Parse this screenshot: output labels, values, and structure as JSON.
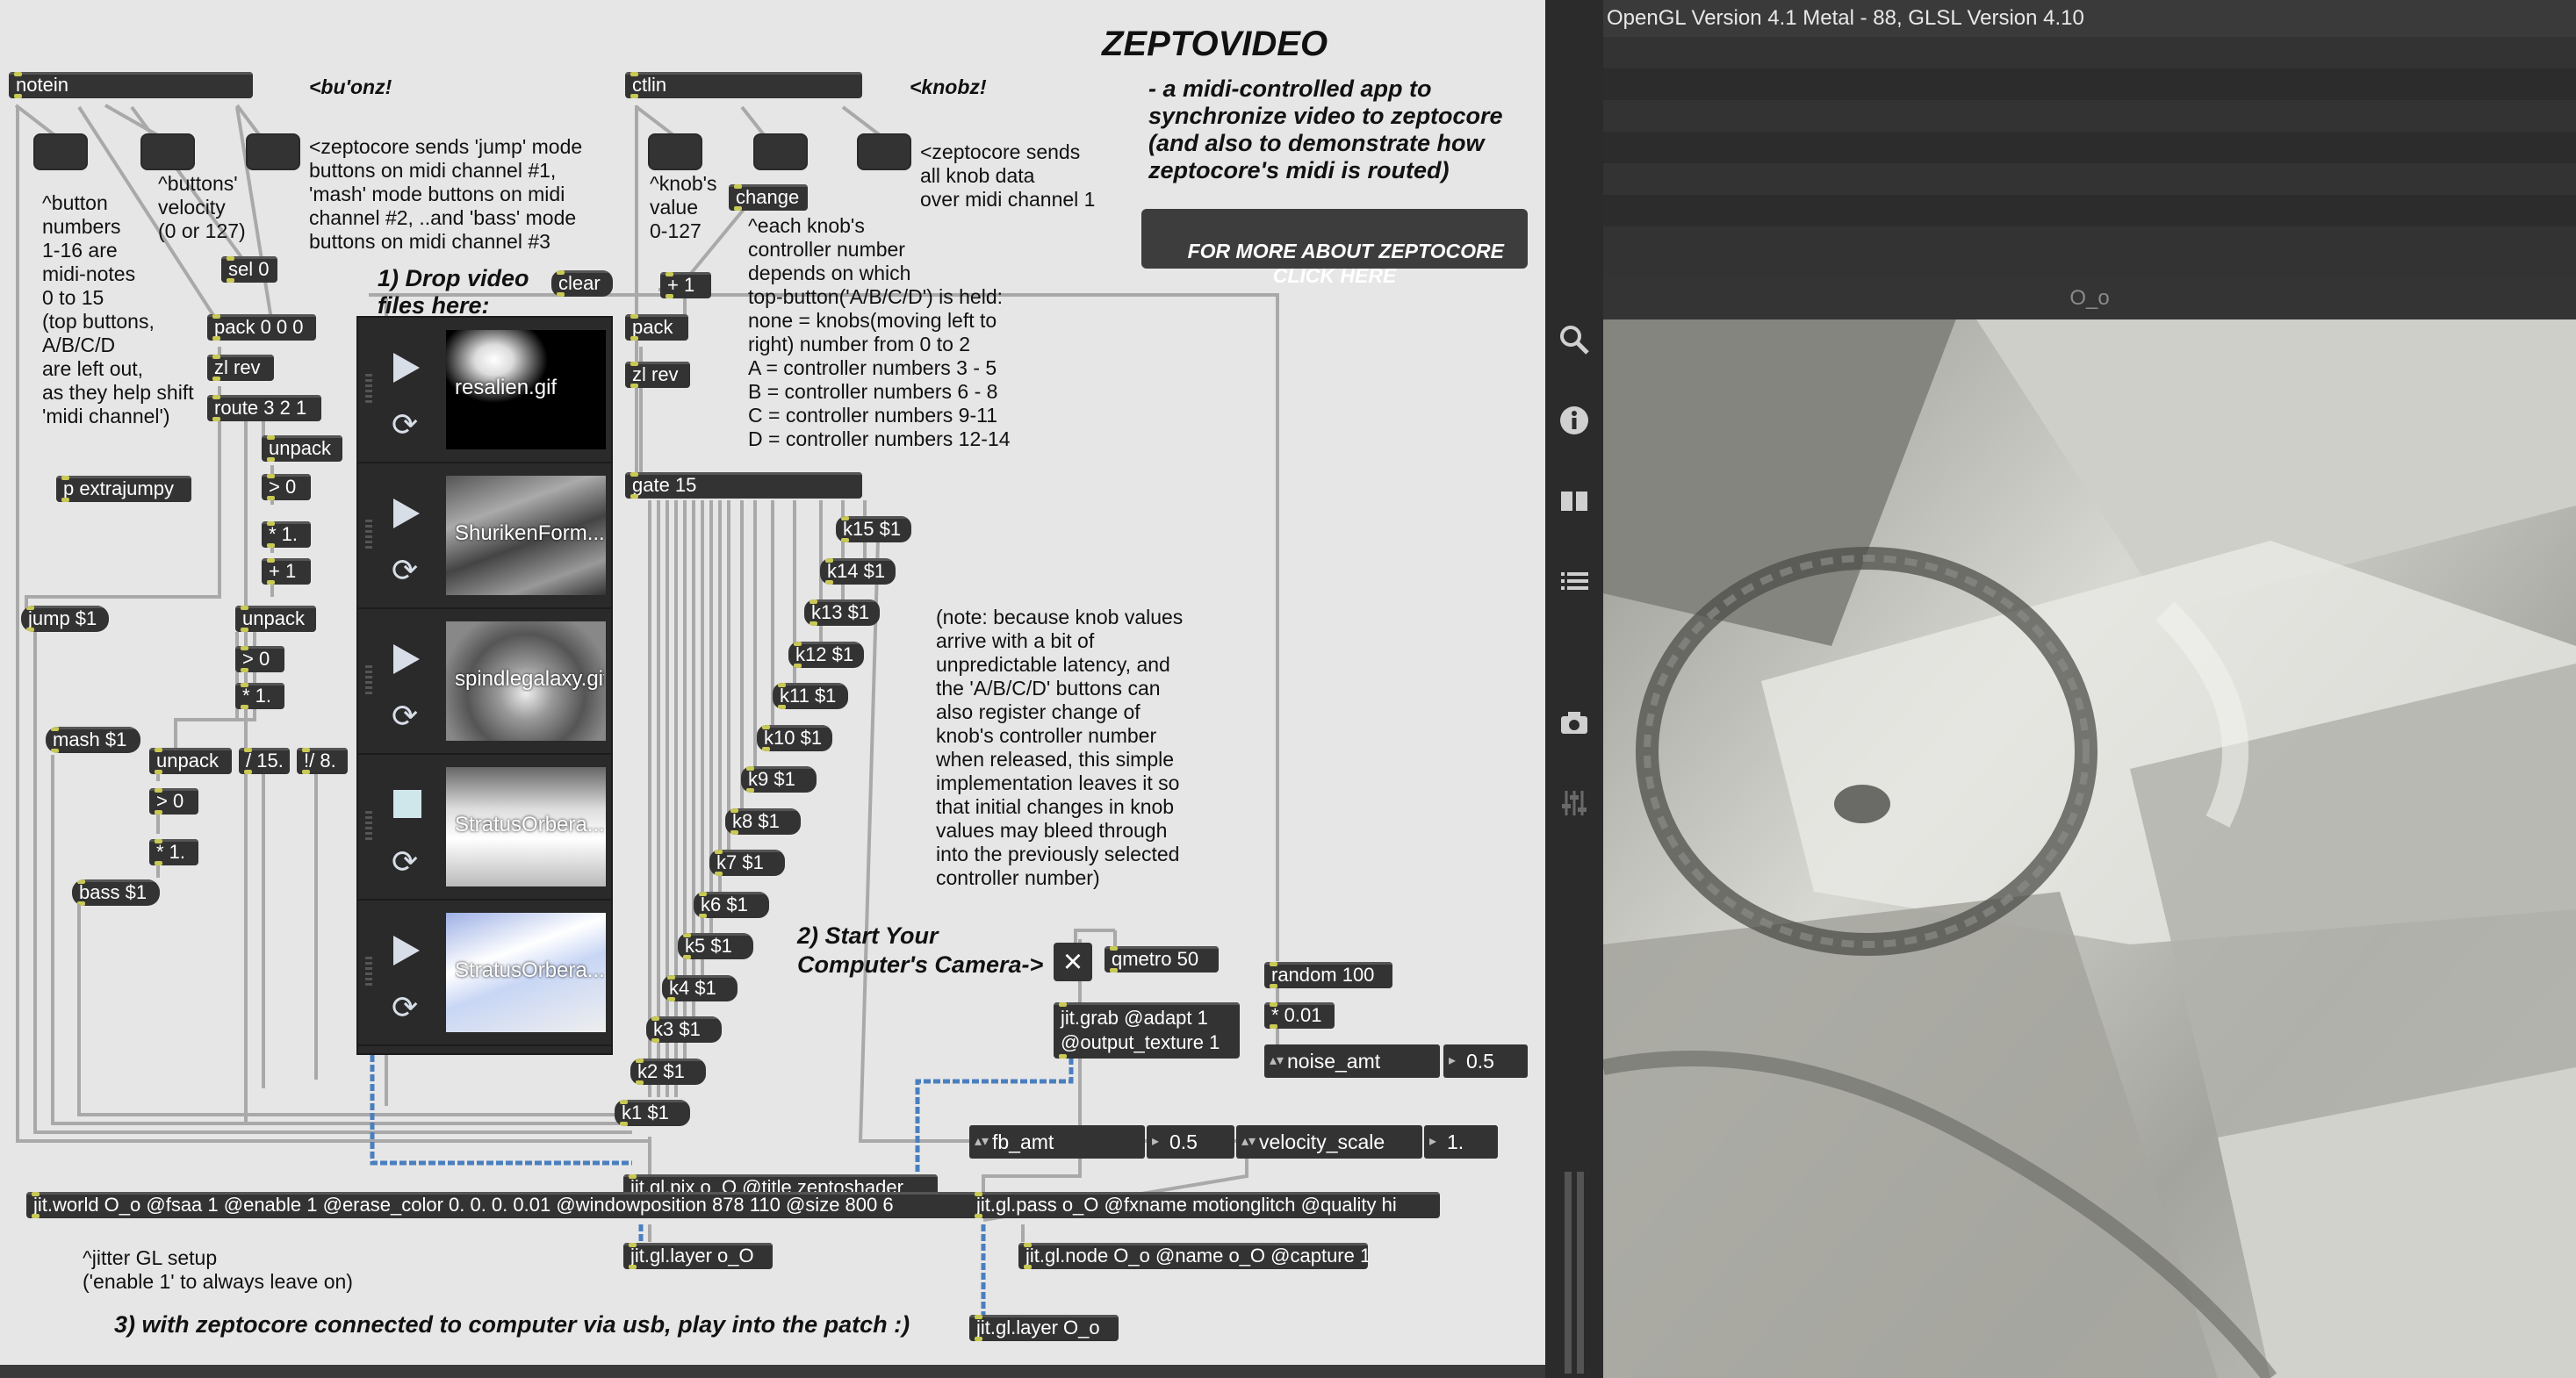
{
  "patcher": {
    "title": "ZEPTOVIDEO",
    "description": "- a midi-controlled app to\nsynchronize video to zeptocore\n(and also to demonstrate how\nzeptocore's midi is routed)",
    "link_button": "FOR MORE ABOUT ZEPTOCORE\nCLICK HERE",
    "step1": "1) Drop video\nfiles here:",
    "step2": "2) Start Your\nComputer's Camera->",
    "step3": "3) with zeptocore connected to computer via usb, play into the patch :)",
    "buonz": "<bu'onz!",
    "knobz": "<knobz!",
    "comment_buttons": "<zeptocore sends 'jump' mode\nbuttons on midi channel #1,\n'mash' mode buttons on midi\nchannel #2, ..and 'bass' mode\nbuttons on midi channel #3",
    "comment_button_numbers": "^button\nnumbers\n1-16 are\nmidi-notes\n0 to 15\n(top buttons,\nA/B/C/D\nare left out,\nas they help shift\n'midi channel')",
    "comment_velocity": "^buttons'\nvelocity\n(0 or 127)",
    "comment_knob_value": "^knob's\nvalue\n0-127",
    "comment_knob_data": "<zeptocore sends\nall knob data\nover midi channel 1",
    "comment_controller": "^each knob's\ncontroller number\ndepends on which\ntop-button('A/B/C/D') is held:\nnone = knobs(moving left to\nright) number from 0 to 2\nA = controller numbers 3 - 5\nB = controller numbers 6 - 8\nC = controller numbers 9-11\nD = controller numbers 12-14",
    "comment_note": "(note: because knob values\narrive with a bit of\nunpredictable latency, and\nthe 'A/B/C/D' buttons can\nalso register change of\nknob's controller number\nwhen released, this simple\nimplementation leaves it so\nthat initial changes in knob\nvalues may bleed through\ninto the previously selected\ncontroller number)",
    "comment_jitter": "^jitter GL setup\n('enable 1' to always leave on)",
    "objects": {
      "notein": "notein",
      "ctlin": "ctlin",
      "change": "change",
      "plus1_a": "+ 1",
      "pack_ctl": "pack",
      "zlrev_ctl": "zl rev",
      "sel0": "sel 0",
      "pack000": "pack 0 0 0",
      "zlrev": "zl rev",
      "route321": "route 3 2 1",
      "unpack1": "unpack",
      "gt0_1": "> 0",
      "mul1_1": "* 1.",
      "plus1_b": "+ 1",
      "p_extrajumpy": "p extrajumpy",
      "jump": "jump $1",
      "unpack2": "unpack",
      "gt0_2": "> 0",
      "mul1_2": "* 1.",
      "mash": "mash $1",
      "unpack3": "unpack",
      "div15": "/ 15.",
      "rdiv8": "!/ 8.",
      "gt0_3": "> 0",
      "mul1_3": "* 1.",
      "bass": "bass $1",
      "clear": "clear",
      "gate15": "gate 15",
      "qmetro": "qmetro 50",
      "jitgrab": "jit.grab @adapt 1\n@output_texture 1",
      "random": "random 100",
      "mul001": "* 0.01",
      "jitglpix": "jit.gl.pix o_O @title zeptoshader",
      "jitworld": "jit.world O_o @fsaa 1 @enable 1 @erase_color 0. 0. 0. 0.01 @windowposition 878 110 @size 800 6",
      "jitglpass": "jit.gl.pass o_O @fxname motionglitch @quality hi",
      "jitgllayer1": "jit.gl.layer o_O",
      "jitglnode": "jit.gl.node O_o @name o_O @capture 1",
      "jitgllayer2": "jit.gl.layer O_o"
    },
    "knobs": [
      "k15 $1",
      "k14 $1",
      "k13 $1",
      "k12 $1",
      "k11 $1",
      "k10 $1",
      "k9 $1",
      "k8 $1",
      "k7 $1",
      "k6 $1",
      "k5 $1",
      "k4 $1",
      "k3 $1",
      "k2 $1",
      "k1 $1"
    ],
    "params": {
      "noise_amt_label": "noise_amt",
      "noise_amt_value": "0.5",
      "fb_amt_label": "fb_amt",
      "fb_amt_value": "0.5",
      "velocity_scale_label": "velocity_scale",
      "velocity_scale_value": "1."
    },
    "playlist": [
      {
        "name": "resalien.gif",
        "state": "play",
        "thumb": "dark-glow"
      },
      {
        "name": "ShurikenForm...",
        "state": "play",
        "thumb": "gray-streaks"
      },
      {
        "name": "spindlegalaxy.gif",
        "state": "play",
        "thumb": "gray-spiral"
      },
      {
        "name": "StratusOrbera...",
        "state": "stop",
        "thumb": "white-sky"
      },
      {
        "name": "StratusOrbera...",
        "state": "play",
        "thumb": "blue-sky"
      }
    ]
  },
  "render_window": {
    "header": "OpenGL Version 4.1 Metal - 88, GLSL Version 4.10",
    "gl_title": "O_o"
  },
  "sidebar": {
    "icons": [
      "search-icon",
      "info-icon",
      "book-icon",
      "list-icon",
      "snapshot-icon",
      "mixer-icon"
    ]
  },
  "colors": {
    "patcher_bg": "#e6e6e6",
    "object_bg": "#333333",
    "inlet": "#c9c955",
    "patchcord": "#a9a9a9",
    "signal_cord": "#4a7fbf"
  }
}
